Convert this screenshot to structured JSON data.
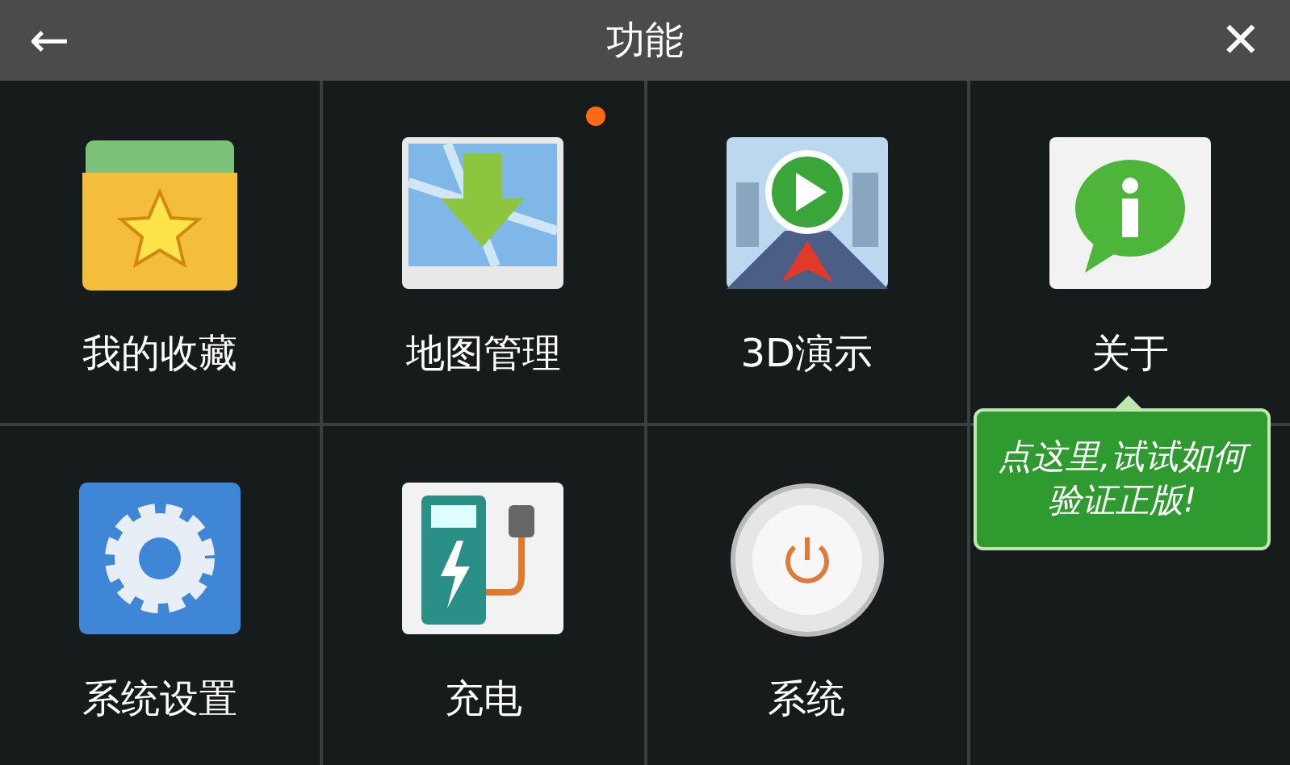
{
  "title_bar": {
    "back": "←",
    "title": "功能",
    "close": "✕"
  },
  "items": [
    {
      "label": "我的收藏",
      "kind": "favorites",
      "new_dot": false
    },
    {
      "label": "地图管理",
      "kind": "map",
      "new_dot": true
    },
    {
      "label": "3D演示",
      "kind": "demo",
      "new_dot": false
    },
    {
      "label": "关于",
      "kind": "about",
      "new_dot": false
    },
    {
      "label": "系统设置",
      "kind": "settings",
      "new_dot": false
    },
    {
      "label": "充电",
      "kind": "charging",
      "new_dot": false
    },
    {
      "label": "系统",
      "kind": "power",
      "new_dot": false
    }
  ],
  "tooltip": "点这里,试试如何验证正版!"
}
